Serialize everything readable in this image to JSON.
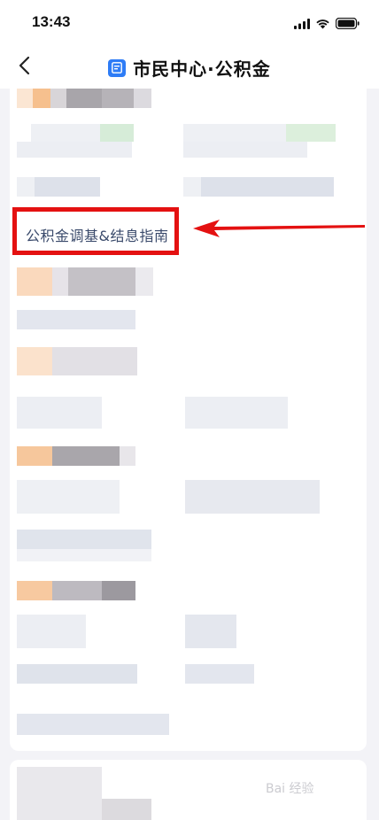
{
  "status_bar": {
    "time": "13:43",
    "icons": [
      "signal-icon",
      "wifi-icon",
      "battery-icon"
    ]
  },
  "nav": {
    "title": "市民中心·公积金",
    "back_icon": "chevron-left-icon",
    "app_icon": "document-icon"
  },
  "content": {
    "guide_link": "公积金调基&结息指南",
    "highlight_color": "#e41111",
    "link_color": "#3a4a6b"
  },
  "watermark": "Bai 经验"
}
